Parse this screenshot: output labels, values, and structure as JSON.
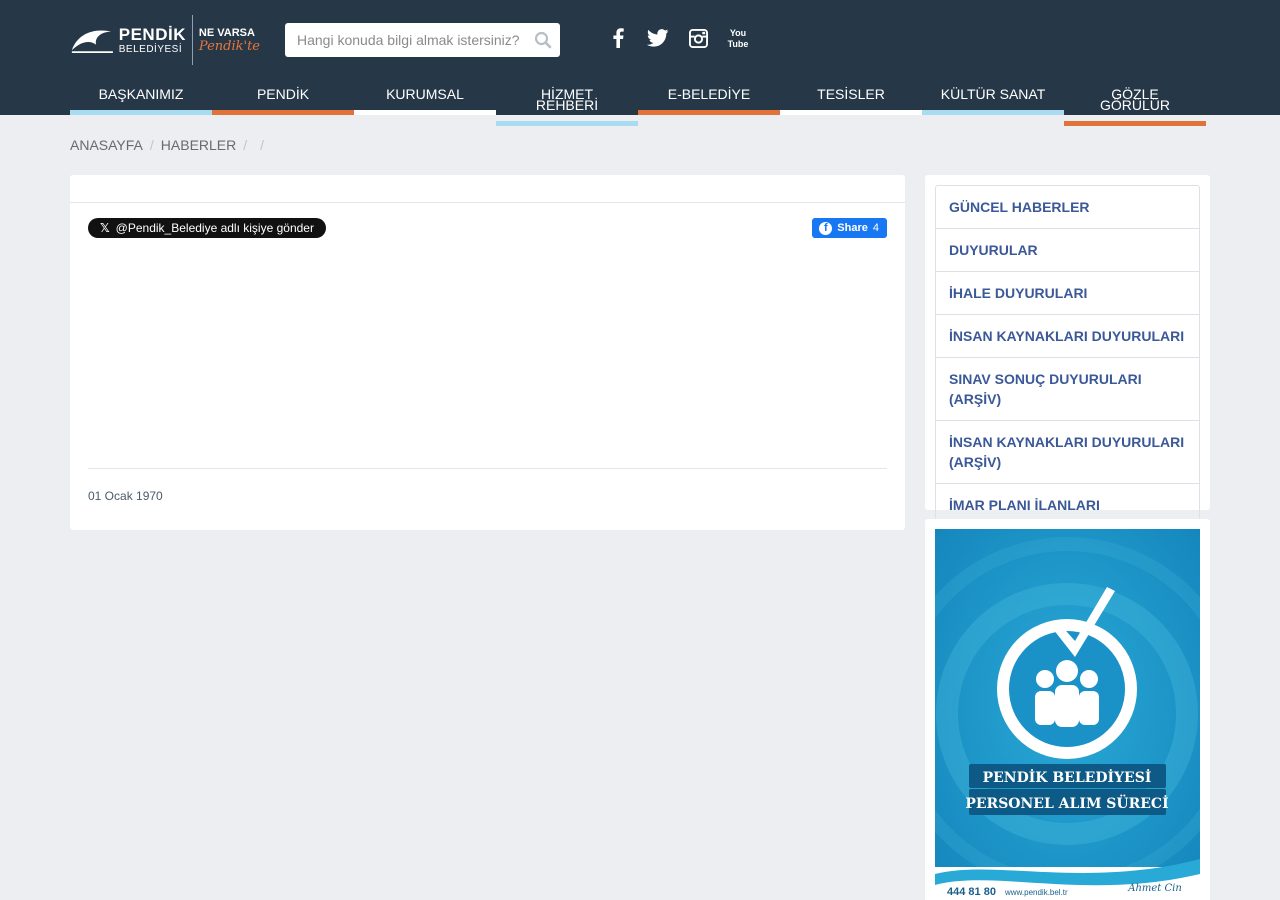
{
  "header": {
    "logo": {
      "name": "PENDİK",
      "sub": "BELEDİYESİ",
      "slogan_top": "NE VARSA",
      "slogan_script": "Pendik'te"
    },
    "search": {
      "placeholder": "Hangi konuda bilgi almak istersiniz?"
    },
    "social": [
      "facebook-icon",
      "twitter-icon",
      "instagram-icon",
      "youtube-icon"
    ]
  },
  "nav": {
    "items": [
      {
        "label": "BAŞKANIMIZ",
        "bar_color": "#a8dcf0"
      },
      {
        "label": "PENDİK",
        "bar_color": "#e0733a"
      },
      {
        "label": "KURUMSAL",
        "bar_color": "#ffffff"
      },
      {
        "label": "HİZMET REHBERİ",
        "bar_color": "#a8dcf0"
      },
      {
        "label": "E-BELEDİYE",
        "bar_color": "#e0733a"
      },
      {
        "label": "TESİSLER",
        "bar_color": "#ffffff"
      },
      {
        "label": "KÜLTÜR SANAT",
        "bar_color": "#a8dcf0"
      },
      {
        "label": "GÖZLE GÖRÜLÜR",
        "bar_color": "#e0733a"
      }
    ]
  },
  "breadcrumb": {
    "home": "ANASAYFA",
    "section": "HABERLER"
  },
  "article": {
    "tweet_label": "@Pendik_Belediye adlı kişiye gönder",
    "fb_label": "Share",
    "fb_count": "4",
    "date": "01 Ocak 1970"
  },
  "sidebar": {
    "items": [
      {
        "label": "GÜNCEL HABERLER"
      },
      {
        "label": "DUYURULAR"
      },
      {
        "label": "İHALE DUYURULARI"
      },
      {
        "label": "İNSAN KAYNAKLARI DUYURULARI"
      },
      {
        "label": "SINAV SONUÇ DUYURULARI (ARŞİV)"
      },
      {
        "label": "İNSAN KAYNAKLARI DUYURULARI (ARŞİV)"
      },
      {
        "label": "İMAR PLANI İLANLARI"
      }
    ]
  },
  "banner": {
    "line1": "PENDİK BELEDİYESİ",
    "line2": "PERSONEL ALIM SÜRECİ",
    "phone": "444 81 80",
    "url": "www.pendik.bel.tr",
    "mayor": "Ahmet Cin"
  },
  "colors": {
    "header_bg": "#263848",
    "orange": "#e0733a",
    "light_blue": "#a8dcf0",
    "link": "#3b5998"
  }
}
